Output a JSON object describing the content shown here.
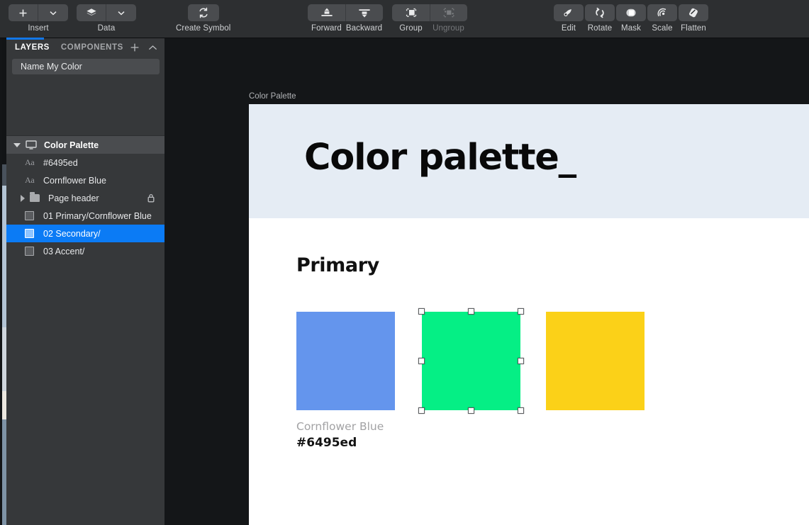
{
  "toolbar": {
    "groups": [
      {
        "name": "insert-data",
        "items": [
          {
            "label": "Insert",
            "icon": "plus-icon",
            "has_caret": true
          },
          {
            "label": "Data",
            "icon": "layers-stack-icon",
            "has_caret": true
          }
        ]
      },
      {
        "name": "symbol",
        "items": [
          {
            "label": "Create Symbol",
            "icon": "refresh-symbol-icon"
          }
        ]
      },
      {
        "name": "arrange",
        "items": [
          {
            "label": "Forward",
            "icon": "move-forward-icon",
            "enabled": true
          },
          {
            "label": "Backward",
            "icon": "move-backward-icon",
            "enabled": true
          },
          {
            "label": "Group",
            "icon": "group-icon",
            "enabled": true
          },
          {
            "label": "Ungroup",
            "icon": "ungroup-icon",
            "enabled": false
          }
        ]
      },
      {
        "name": "edit-tools",
        "items": [
          {
            "label": "Edit",
            "icon": "edit-node-icon"
          },
          {
            "label": "Rotate",
            "icon": "rotate-icon"
          },
          {
            "label": "Mask",
            "icon": "mask-icon"
          },
          {
            "label": "Scale",
            "icon": "scale-icon"
          },
          {
            "label": "Flatten",
            "icon": "flatten-icon"
          }
        ]
      }
    ]
  },
  "sidebar": {
    "tabs": [
      {
        "label": "LAYERS",
        "active": true
      },
      {
        "label": "COMPONENTS",
        "active": false
      }
    ],
    "actions": [
      {
        "name": "add-layer-icon",
        "glyph": "+"
      },
      {
        "name": "collapse-panel-icon",
        "glyph": "^"
      }
    ],
    "name_field": {
      "value": "",
      "placeholder": "Name My Color"
    },
    "artboard": {
      "label": "Color Palette",
      "expanded": true,
      "icon": "artboard-icon"
    },
    "layers": [
      {
        "label": "#6495ed",
        "icon": "text-layer-icon",
        "type": "text",
        "selected": false,
        "locked": false,
        "expandable": false
      },
      {
        "label": "Cornflower Blue",
        "icon": "text-layer-icon",
        "type": "text",
        "selected": false,
        "locked": false,
        "expandable": false
      },
      {
        "label": "Page header",
        "icon": "folder-icon",
        "type": "group",
        "selected": false,
        "locked": true,
        "expandable": true
      },
      {
        "label": "01 Primary/Cornflower Blue",
        "icon": "shape-layer-icon",
        "type": "shape",
        "selected": false,
        "locked": false,
        "expandable": false
      },
      {
        "label": "02 Secondary/",
        "icon": "shape-layer-icon",
        "type": "shape",
        "selected": true,
        "locked": false,
        "expandable": false
      },
      {
        "label": "03 Accent/",
        "icon": "shape-layer-icon",
        "type": "shape",
        "selected": false,
        "locked": false,
        "expandable": false
      }
    ]
  },
  "canvas": {
    "artboard_title": "Color Palette",
    "header_title": "Color palette_",
    "section_title": "Primary",
    "swatches": [
      {
        "name": "primary-swatch-cornflower-blue",
        "color": "#6495ed",
        "selected": false
      },
      {
        "name": "secondary-swatch-green",
        "color": "#05ef85",
        "selected": true
      },
      {
        "name": "accent-swatch-yellow",
        "color": "#fbd118",
        "selected": false
      }
    ],
    "caption": {
      "name": "Cornflower Blue",
      "hex": "#6495ed"
    }
  },
  "colors": {
    "accent_blue": "#0b7bf5",
    "toolbar_bg": "#2d2f31",
    "sidebar_bg": "#36383a",
    "canvas_bg": "#141618",
    "header_band": "#e5ecf4"
  }
}
